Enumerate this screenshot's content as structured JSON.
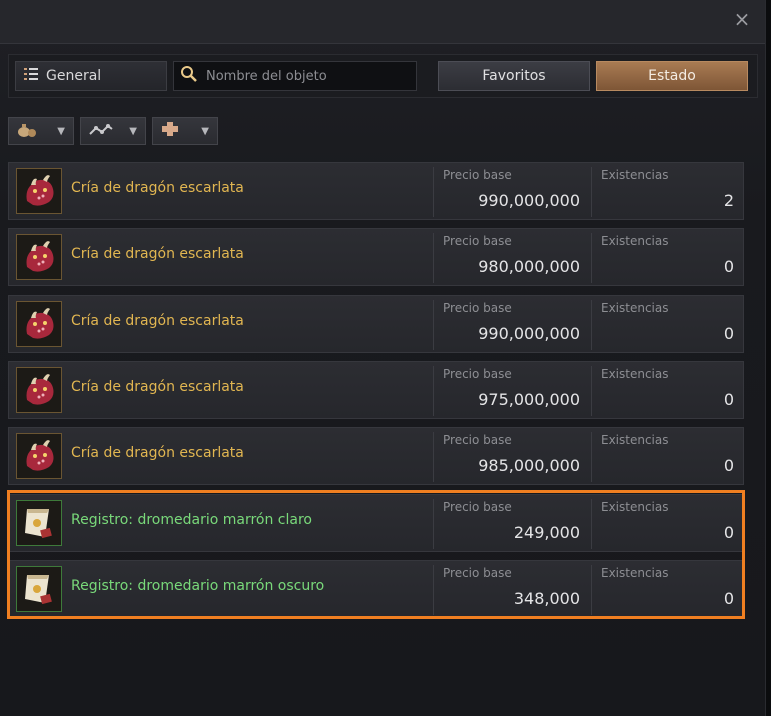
{
  "window": {
    "close_glyph": "×"
  },
  "toolbar": {
    "category_label": "General",
    "search_placeholder": "Nombre del objeto",
    "search_value": "",
    "favorites_label": "Favoritos",
    "status_label": "Estado"
  },
  "filters": [
    {
      "icon": "money-bag-icon"
    },
    {
      "icon": "trend-line-icon"
    },
    {
      "icon": "plus-icon"
    }
  ],
  "columns": {
    "price_label": "Precio base",
    "stock_label": "Existencias"
  },
  "items": [
    {
      "name": "Cría de dragón escarlata",
      "price": "990,000,000",
      "stock": "2",
      "icon": "dragon-icon",
      "color": "#e1b651"
    },
    {
      "name": "Cría de dragón escarlata",
      "price": "980,000,000",
      "stock": "0",
      "icon": "dragon-icon",
      "color": "#e1b651"
    },
    {
      "name": "Cría de dragón escarlata",
      "price": "990,000,000",
      "stock": "0",
      "icon": "dragon-icon",
      "color": "#e1b651"
    },
    {
      "name": "Cría de dragón escarlata",
      "price": "975,000,000",
      "stock": "0",
      "icon": "dragon-icon",
      "color": "#e1b651"
    },
    {
      "name": "Cría de dragón escarlata",
      "price": "985,000,000",
      "stock": "0",
      "icon": "dragon-icon",
      "color": "#e1b651"
    },
    {
      "name": "Registro: dromedario marrón claro",
      "price": "249,000",
      "stock": "0",
      "icon": "scroll-icon",
      "color": "#79d97a"
    },
    {
      "name": "Registro: dromedario marrón oscuro",
      "price": "348,000",
      "stock": "0",
      "icon": "scroll-icon",
      "color": "#79d97a"
    }
  ],
  "colors": {
    "accent": "#a97b53",
    "highlight": "#f07f21",
    "gold_text": "#e1b651",
    "green_text": "#79d97a"
  }
}
